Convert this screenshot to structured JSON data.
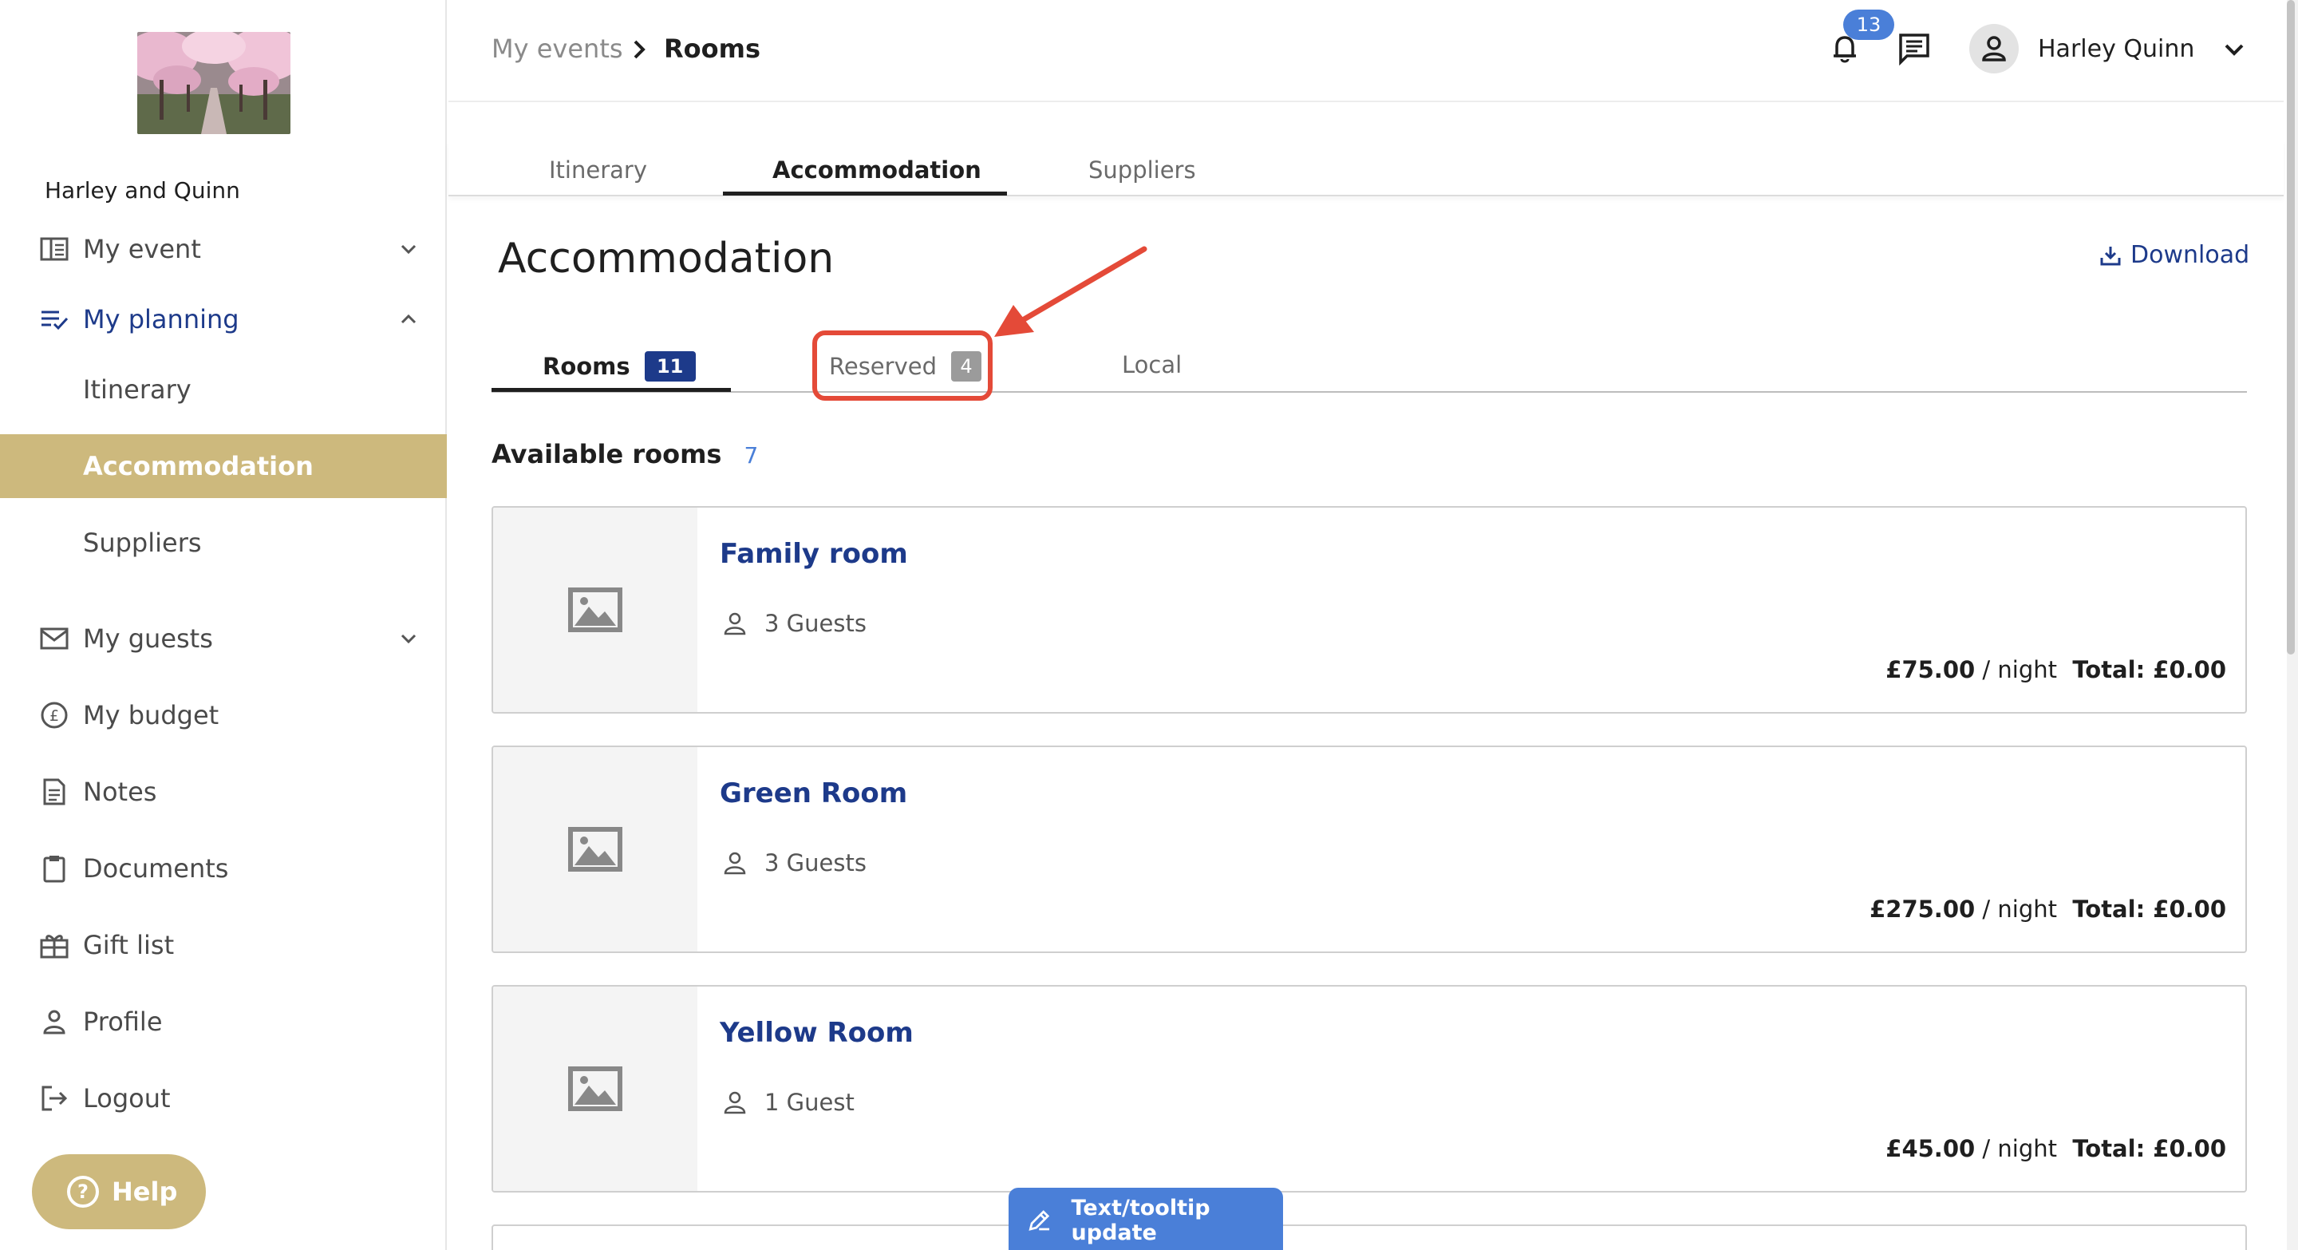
{
  "sidebar": {
    "event_name": "Harley and Quinn",
    "items": [
      {
        "label": "My event",
        "icon": "book-open-icon"
      },
      {
        "label": "My planning",
        "icon": "checklist-icon"
      },
      {
        "label": "My guests",
        "icon": "envelope-icon"
      },
      {
        "label": "My budget",
        "icon": "pound-coin-icon"
      },
      {
        "label": "Notes",
        "icon": "note-icon"
      },
      {
        "label": "Documents",
        "icon": "clipboard-icon"
      },
      {
        "label": "Gift list",
        "icon": "gift-icon"
      },
      {
        "label": "Profile",
        "icon": "person-icon"
      },
      {
        "label": "Logout",
        "icon": "logout-icon"
      }
    ],
    "planning_sub": [
      {
        "label": "Itinerary"
      },
      {
        "label": "Accommodation"
      },
      {
        "label": "Suppliers"
      }
    ],
    "help_label": "Help",
    "accent": "#cdb97d"
  },
  "header": {
    "breadcrumb": [
      "My events",
      "Rooms"
    ],
    "notification_count": "13",
    "user_name": "Harley Quinn"
  },
  "main_tabs": [
    "Itinerary",
    "Accommodation",
    "Suppliers"
  ],
  "page": {
    "title": "Accommodation",
    "download_label": "Download"
  },
  "sub_tabs": [
    {
      "label": "Rooms",
      "count": "11"
    },
    {
      "label": "Reserved",
      "count": "4"
    },
    {
      "label": "Local"
    }
  ],
  "section": {
    "title": "Available rooms",
    "count": "7"
  },
  "rooms": [
    {
      "name": "Family room",
      "guests": "3 Guests",
      "price": "£75.00",
      "per": "/ night",
      "total": "Total: £0.00"
    },
    {
      "name": "Green Room",
      "guests": "3 Guests",
      "price": "£275.00",
      "per": "/ night",
      "total": "Total: £0.00"
    },
    {
      "name": "Yellow Room",
      "guests": "1 Guest",
      "price": "£45.00",
      "per": "/ night",
      "total": "Total: £0.00"
    }
  ],
  "floating": {
    "label": "Text/tooltip update"
  },
  "colors": {
    "brand_blue": "#1d3a8a",
    "link_blue": "#4a7fd8",
    "annotation_red": "#e44a38"
  }
}
